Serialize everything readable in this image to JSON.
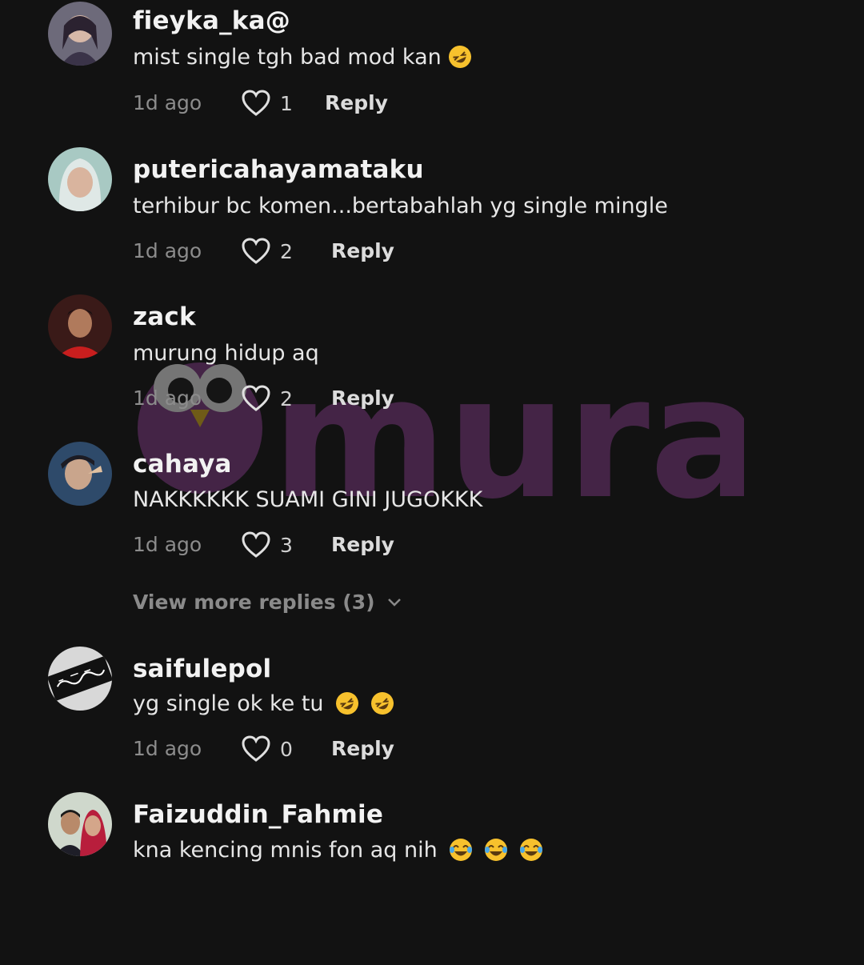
{
  "comments": [
    {
      "username": "fieyka_ka@",
      "text": "mist single tgh bad mod kan",
      "emojis": [
        "rolling-on-floor-laughing"
      ],
      "time": "1d ago",
      "likes": "1",
      "reply_label": "Reply"
    },
    {
      "username": "putericahayamataku",
      "text": "terhibur bc komen...bertabahlah yg single mingle",
      "emojis": [],
      "time": "1d ago",
      "likes": "2",
      "reply_label": "Reply"
    },
    {
      "username": "zack",
      "text": "murung hidup aq",
      "emojis": [],
      "time": "1d ago",
      "likes": "2",
      "reply_label": "Reply"
    },
    {
      "username": "cahaya",
      "text": "NAKKKKKK SUAMI GINI JUGOKKK",
      "emojis": [],
      "time": "1d ago",
      "likes": "3",
      "reply_label": "Reply"
    },
    {
      "username": "saifulepol",
      "text": "yg single ok ke tu",
      "emojis": [
        "rolling-on-floor-laughing",
        "rolling-on-floor-laughing"
      ],
      "time": "1d ago",
      "likes": "0",
      "reply_label": "Reply"
    },
    {
      "username": "Faizuddin_Fahmie",
      "text": "kna kencing mnis fon aq nih",
      "emojis": [
        "tears-of-joy",
        "tears-of-joy",
        "tears-of-joy"
      ],
      "time": "",
      "likes": "",
      "reply_label": ""
    }
  ],
  "view_more": {
    "label": "View more replies (3)"
  },
  "watermark": {
    "brand": "murai",
    "color": "#8a3f8f"
  },
  "colors": {
    "background": "#121212",
    "text_primary": "#f2f2f2",
    "text_muted": "#8c8c8c"
  }
}
